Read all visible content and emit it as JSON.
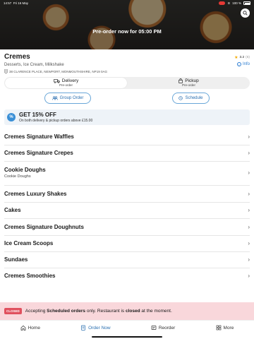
{
  "status_bar": {
    "time": "14:57",
    "date": "Fri 16 May",
    "battery": "100 %"
  },
  "hero": {
    "preorder_text": "Pre-order now for 05:00 PM"
  },
  "restaurant": {
    "name": "Cremes",
    "cuisine": "Desserts, Ice Cream, Milkshake",
    "address": "38 CLARENCE PLACE, NEWPORT, MONMOUTHSHIRE, NP19 0AG",
    "rating": "3.2",
    "rating_count": "(6)",
    "info_label": "Info"
  },
  "order_mode": {
    "delivery": {
      "label": "Delivery",
      "sub": "Pre-order"
    },
    "pickup": {
      "label": "Pickup",
      "sub": "Pre-order"
    },
    "selected": "delivery"
  },
  "actions": {
    "group_order": "Group Order",
    "schedule": "Schedule"
  },
  "promo": {
    "icon": "%",
    "title": "GET 15% OFF",
    "subtitle": "On both delivery & pickup orders above £15.00"
  },
  "categories": [
    {
      "name": "Cremes Signature Waffles",
      "sub": ""
    },
    {
      "name": "Cremes Signature Crepes",
      "sub": ""
    },
    {
      "name": "Cookie Doughs",
      "sub": "Cookie Doughs"
    },
    {
      "name": "Cremes Luxury Shakes",
      "sub": ""
    },
    {
      "name": "Cakes",
      "sub": ""
    },
    {
      "name": "Cremes Signature Doughnuts",
      "sub": ""
    },
    {
      "name": "Ice Cream Scoops",
      "sub": ""
    },
    {
      "name": "Sundaes",
      "sub": ""
    },
    {
      "name": "Cremes Smoothies",
      "sub": ""
    }
  ],
  "notice": {
    "badge": "CLOSED",
    "part1": "Accepting ",
    "bold1": "Scheduled orders",
    "part2": " only. Restaurant is ",
    "bold2": "closed",
    "part3": " at the moment."
  },
  "bottom_nav": [
    {
      "label": "Home",
      "icon": "home-icon"
    },
    {
      "label": "Order Now",
      "icon": "order-icon"
    },
    {
      "label": "Reorder",
      "icon": "reorder-icon"
    },
    {
      "label": "More",
      "icon": "more-icon"
    }
  ],
  "colors": {
    "accent": "#2a6fb0",
    "notice_bg": "#f9d7db",
    "closed": "#e0505e",
    "star": "#f2a900"
  }
}
